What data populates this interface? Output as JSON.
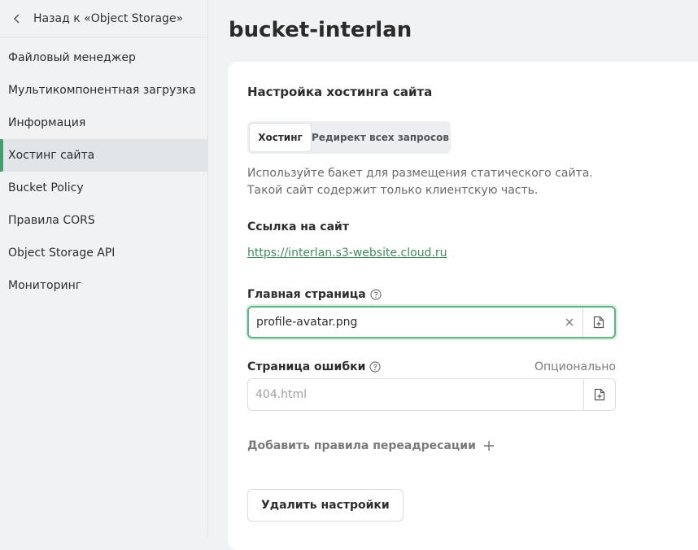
{
  "sidebar": {
    "back_label": "Назад к «Object Storage»",
    "items": [
      {
        "label": "Файловый менеджер",
        "active": false
      },
      {
        "label": "Мультикомпонентная загрузка",
        "active": false
      },
      {
        "label": "Информация",
        "active": false
      },
      {
        "label": "Хостинг сайта",
        "active": true
      },
      {
        "label": "Bucket Policy",
        "active": false
      },
      {
        "label": "Правила CORS",
        "active": false
      },
      {
        "label": "Object Storage API",
        "active": false
      },
      {
        "label": "Мониторинг",
        "active": false
      }
    ]
  },
  "page": {
    "title": "bucket-interlan"
  },
  "hosting": {
    "section_title": "Настройка хостинга сайта",
    "tabs": [
      {
        "label": "Хостинг",
        "selected": true
      },
      {
        "label": "Редирект всех запросов",
        "selected": false
      }
    ],
    "description": "Используйте бакет для размещения статического сайта. Такой сайт содержит только клиентскую часть.",
    "site_link_label": "Ссылка на сайт",
    "site_link": "https://interlan.s3-website.cloud.ru",
    "main_page": {
      "label": "Главная страница",
      "value": "profile-avatar.png"
    },
    "error_page": {
      "label": "Страница ошибки",
      "optional_label": "Опционально",
      "placeholder": "404.html"
    },
    "add_rules_label": "Добавить правила переадресации",
    "delete_label": "Удалить настройки"
  },
  "colors": {
    "accent": "#3fa06d",
    "link": "#3f8b5b",
    "focus_border": "#5fb585"
  }
}
